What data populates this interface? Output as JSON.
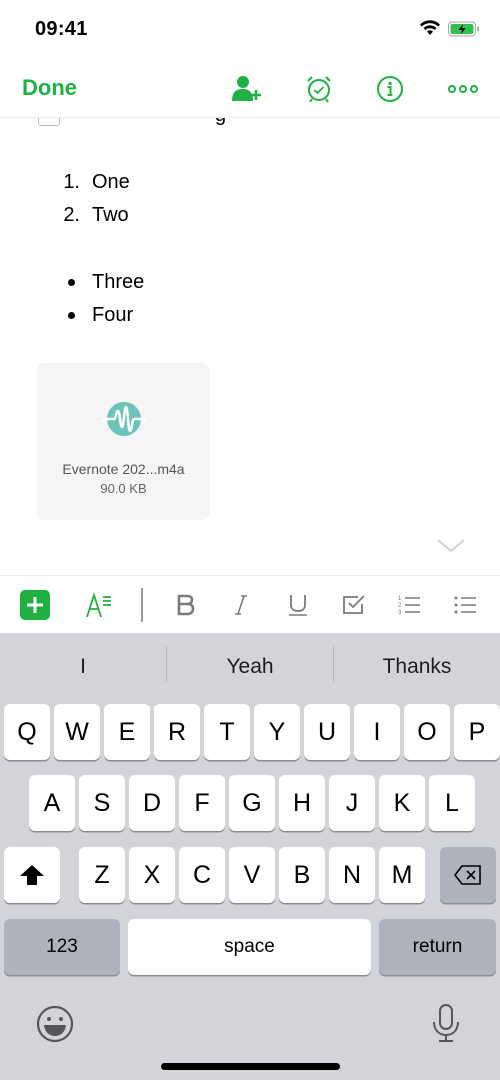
{
  "status_bar": {
    "time": "09:41",
    "wifi_icon": "wifi-icon",
    "battery_icon": "battery-charging-icon"
  },
  "nav": {
    "done_label": "Done",
    "icons": [
      "add-user-icon",
      "alarm-reminder-icon",
      "info-icon",
      "more-icon"
    ],
    "accent_color": "#1fb141"
  },
  "note": {
    "numbered_list": [
      {
        "marker": "1.",
        "text": "One"
      },
      {
        "marker": "2.",
        "text": "Two"
      }
    ],
    "bullet_list": [
      {
        "text": "Three"
      },
      {
        "text": "Four"
      }
    ],
    "attachment": {
      "name": "Evernote 202...m4a",
      "size": "90.0 KB",
      "icon": "audio-waveform-icon",
      "icon_color": "#6cc3b8"
    }
  },
  "format_toolbar": {
    "items": [
      "add-icon",
      "text-style-icon",
      "bold-icon",
      "italic-icon",
      "underline-icon",
      "checkbox-icon",
      "numbered-list-icon",
      "bulleted-list-icon"
    ]
  },
  "keyboard": {
    "suggestions": [
      "I",
      "Yeah",
      "Thanks"
    ],
    "row1": [
      "Q",
      "W",
      "E",
      "R",
      "T",
      "Y",
      "U",
      "I",
      "O",
      "P"
    ],
    "row2": [
      "A",
      "S",
      "D",
      "F",
      "G",
      "H",
      "J",
      "K",
      "L"
    ],
    "row3": [
      "Z",
      "X",
      "C",
      "V",
      "B",
      "N",
      "M"
    ],
    "numbers_label": "123",
    "space_label": "space",
    "return_label": "return"
  }
}
